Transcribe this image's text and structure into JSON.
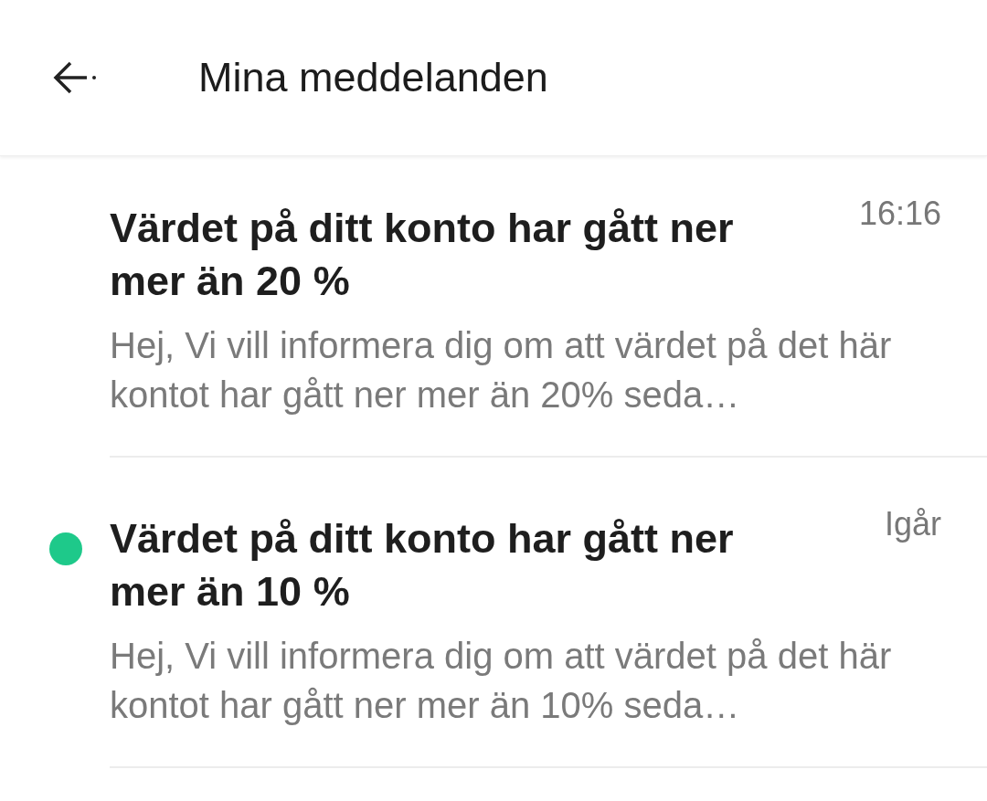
{
  "header": {
    "title": "Mina meddelanden"
  },
  "messages": [
    {
      "title": "Värdet på ditt konto har gått ner mer än 20 %",
      "time": "16:16",
      "preview": "Hej, Vi vill informera dig om att värdet på det här kontot har gått ner mer än 20% seda…",
      "unread": false
    },
    {
      "title": "Värdet på ditt konto har gått ner mer än 10 %",
      "time": "Igår",
      "preview": "Hej, Vi vill informera dig om att värdet på det här kontot har gått ner mer än 10% seda…",
      "unread": true
    }
  ]
}
